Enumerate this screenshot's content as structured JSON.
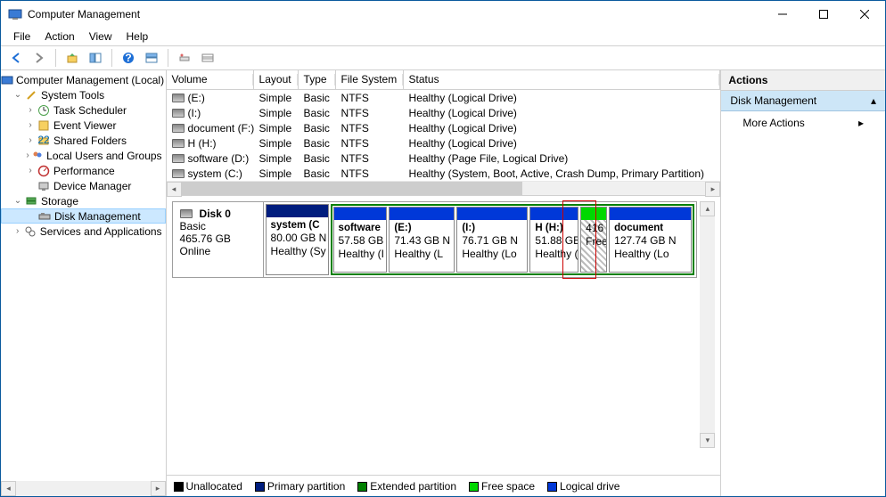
{
  "titlebar": {
    "title": "Computer Management"
  },
  "menu": {
    "file": "File",
    "action": "Action",
    "view": "View",
    "help": "Help"
  },
  "tree": {
    "root": "Computer Management (Local)",
    "systools": "System Tools",
    "tasks": "Task Scheduler",
    "eventv": "Event Viewer",
    "shared": "Shared Folders",
    "lusers": "Local Users and Groups",
    "perf": "Performance",
    "devmgr": "Device Manager",
    "storage": "Storage",
    "diskmgmt": "Disk Management",
    "services": "Services and Applications"
  },
  "vol_header": {
    "volume": "Volume",
    "layout": "Layout",
    "type": "Type",
    "fs": "File System",
    "status": "Status"
  },
  "volumes": [
    {
      "name": "(E:)",
      "layout": "Simple",
      "type": "Basic",
      "fs": "NTFS",
      "status": "Healthy (Logical Drive)"
    },
    {
      "name": "(I:)",
      "layout": "Simple",
      "type": "Basic",
      "fs": "NTFS",
      "status": "Healthy (Logical Drive)"
    },
    {
      "name": "document (F:)",
      "layout": "Simple",
      "type": "Basic",
      "fs": "NTFS",
      "status": "Healthy (Logical Drive)"
    },
    {
      "name": "H (H:)",
      "layout": "Simple",
      "type": "Basic",
      "fs": "NTFS",
      "status": "Healthy (Logical Drive)"
    },
    {
      "name": "software (D:)",
      "layout": "Simple",
      "type": "Basic",
      "fs": "NTFS",
      "status": "Healthy (Page File, Logical Drive)"
    },
    {
      "name": "system (C:)",
      "layout": "Simple",
      "type": "Basic",
      "fs": "NTFS",
      "status": "Healthy (System, Boot, Active, Crash Dump, Primary Partition)"
    }
  ],
  "disk": {
    "label": "Disk 0",
    "type": "Basic",
    "size": "465.76 GB",
    "status": "Online",
    "partitions": [
      {
        "name": "system  (C",
        "size": "80.00 GB N",
        "status": "Healthy (Sy"
      },
      {
        "name": "software",
        "size": "57.58 GB I",
        "status": "Healthy (I"
      },
      {
        "name": "(E:)",
        "size": "71.43 GB N",
        "status": "Healthy (L"
      },
      {
        "name": "(I:)",
        "size": "76.71 GB N",
        "status": "Healthy (Lo"
      },
      {
        "name": "H  (H:)",
        "size": "51.88 GB",
        "status": "Healthy ("
      },
      {
        "name": "",
        "size": "416",
        "status": "Free"
      },
      {
        "name": "document",
        "size": "127.74 GB N",
        "status": "Healthy (Lo"
      }
    ]
  },
  "legend": {
    "un": "Unallocated",
    "pp": "Primary partition",
    "ep": "Extended partition",
    "fs": "Free space",
    "ld": "Logical drive"
  },
  "actions": {
    "header": "Actions",
    "dm": "Disk Management",
    "more": "More Actions"
  }
}
